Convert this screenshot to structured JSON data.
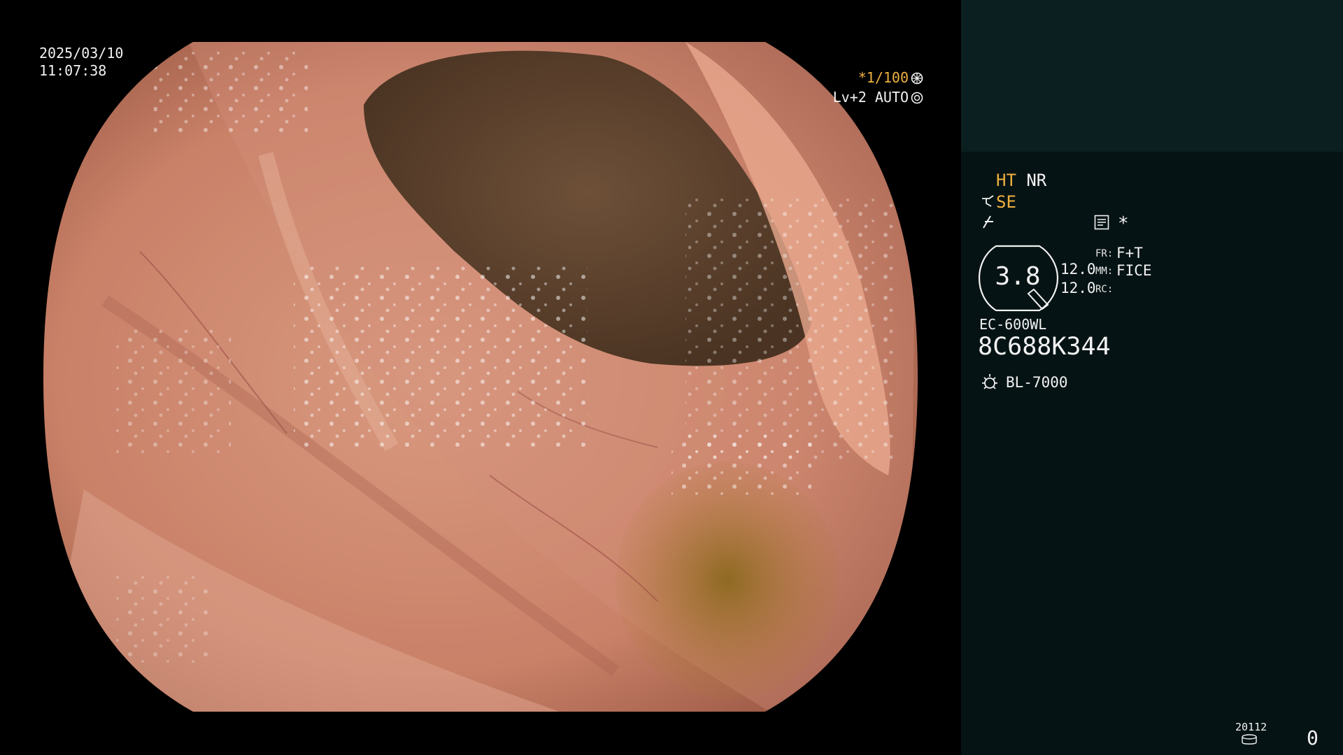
{
  "overlay": {
    "date": "2025/03/10",
    "time": "11:07:38",
    "shutter": "*1/100",
    "iris_mode": "Lv+2 AUTO"
  },
  "panel": {
    "ht": "HT",
    "nr": "NR",
    "se": "SE",
    "zoom_value": "3.8",
    "value_1": "12.0",
    "value_2": "12.0",
    "fr_label": "FR:",
    "fr_value": "F+T",
    "mm_label": "MM:",
    "mm_value": "FICE",
    "rc_label": "RC:",
    "scope_model": "EC-600WL",
    "scope_serial": "8C688K344",
    "light_source": "BL-7000",
    "media_id": "20112",
    "media_count": "0"
  },
  "colors": {
    "accent_orange": "#f0b040",
    "panel_bg": "#061314",
    "panel_top_bg": "#0b1f20"
  },
  "icons": [
    "shutter-icon",
    "iris-icon",
    "scope-tip-icon",
    "structure-icon",
    "memo-icon",
    "light-source-icon",
    "media-icon"
  ]
}
